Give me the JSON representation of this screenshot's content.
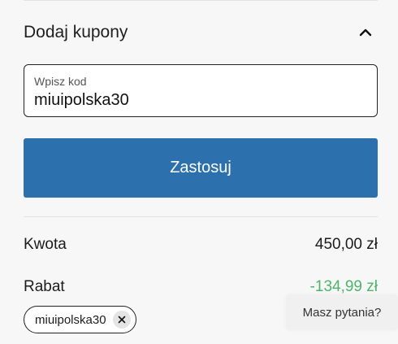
{
  "coupon": {
    "title": "Dodaj kupony",
    "toggle_icon": "chevron-up-icon",
    "input_label": "Wpisz kod",
    "input_value": "miuipolska30",
    "apply_label": "Zastosuj"
  },
  "summary": {
    "amount_label": "Kwota",
    "amount_value": "450,00 zł",
    "discount_label": "Rabat",
    "discount_value": "-134,99 zł"
  },
  "applied_coupon": {
    "code": "miuipolska30",
    "remove_icon": "close-icon"
  },
  "help": {
    "label": "Masz pytania?"
  },
  "colors": {
    "primary": "#2c70ad",
    "discount": "#4db56a"
  }
}
